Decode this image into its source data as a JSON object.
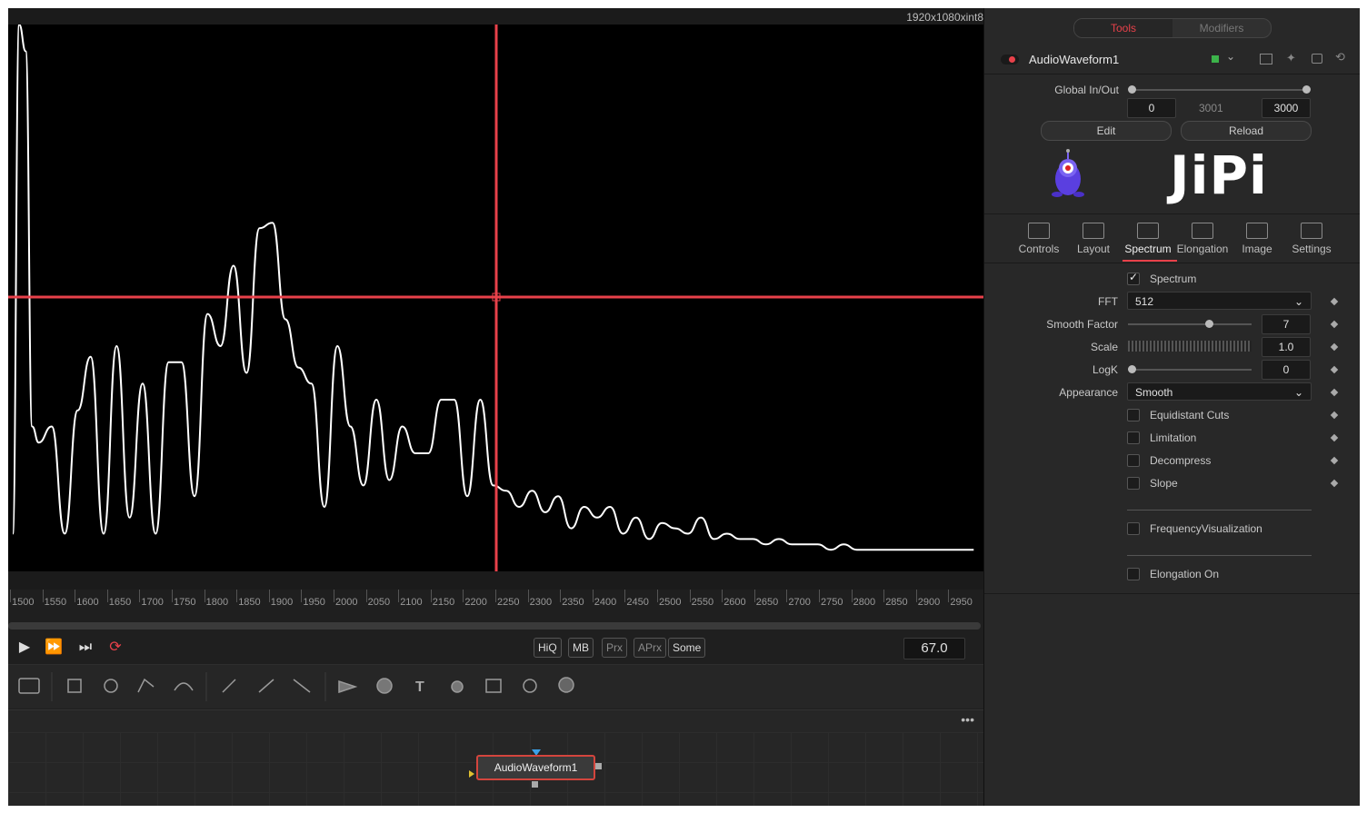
{
  "viewer": {
    "resolution": "1920x1080xint8",
    "chart_data": {
      "type": "line",
      "title": "",
      "series": [
        {
          "x": [
            1500,
            1510,
            1520,
            1530,
            1540,
            1560,
            1580,
            1600,
            1620,
            1640,
            1660,
            1680,
            1700,
            1720,
            1740,
            1760,
            1780,
            1800,
            1820,
            1840,
            1860,
            1880,
            1900,
            1920,
            1940,
            1960,
            1980,
            2000,
            2020,
            2040,
            2060,
            2080,
            2100,
            2120,
            2140,
            2160,
            2180,
            2200,
            2220,
            2240,
            2260,
            2280,
            2300,
            2320,
            2340,
            2360,
            2380,
            2400,
            2420,
            2440,
            2460,
            2480,
            2500,
            2520,
            2540,
            2560,
            2580,
            2600,
            2620,
            2640,
            2660,
            2680,
            2700,
            2720,
            2740,
            2760,
            2780,
            2800,
            2820,
            2840,
            2860,
            2880,
            2900,
            2920,
            2940,
            2960,
            2980
          ],
          "values": [
            0.05,
            1.0,
            0.95,
            0.25,
            0.22,
            0.25,
            0.05,
            0.28,
            0.38,
            0.05,
            0.4,
            0.08,
            0.33,
            0.05,
            0.37,
            0.37,
            0.12,
            0.46,
            0.4,
            0.55,
            0.35,
            0.62,
            0.63,
            0.45,
            0.36,
            0.33,
            0.1,
            0.4,
            0.25,
            0.14,
            0.3,
            0.15,
            0.25,
            0.2,
            0.2,
            0.3,
            0.3,
            0.12,
            0.3,
            0.14,
            0.13,
            0.1,
            0.13,
            0.09,
            0.12,
            0.06,
            0.1,
            0.08,
            0.1,
            0.05,
            0.08,
            0.04,
            0.07,
            0.06,
            0.05,
            0.08,
            0.04,
            0.05,
            0.04,
            0.04,
            0.03,
            0.04,
            0.03,
            0.03,
            0.03,
            0.02,
            0.03,
            0.02,
            0.02,
            0.02,
            0.02,
            0.02,
            0.02,
            0.02,
            0.02,
            0.02,
            0.02
          ]
        }
      ]
    }
  },
  "ruler": {
    "ticks": [
      "1500",
      "1550",
      "1600",
      "1650",
      "1700",
      "1750",
      "1800",
      "1850",
      "1900",
      "1950",
      "2000",
      "2050",
      "2100",
      "2150",
      "2200",
      "2250",
      "2300",
      "2350",
      "2400",
      "2450",
      "2500",
      "2550",
      "2600",
      "2650",
      "2700",
      "2750",
      "2800",
      "2850",
      "2900",
      "2950"
    ]
  },
  "transport": {
    "quality": [
      {
        "label": "HiQ",
        "dim": false
      },
      {
        "label": "MB",
        "dim": false
      },
      {
        "label": "Prx",
        "dim": true
      },
      {
        "label": "APrx",
        "dim": true
      },
      {
        "label": "Some",
        "dim": false
      }
    ],
    "frame": "67.0"
  },
  "flow": {
    "node_label": "AudioWaveform1"
  },
  "inspector": {
    "tab_tools": "Tools",
    "tab_modifiers": "Modifiers",
    "node_name": "AudioWaveform1",
    "global_label": "Global In/Out",
    "global_in": "0",
    "global_mid": "3001",
    "global_out": "3000",
    "edit_label": "Edit",
    "reload_label": "Reload",
    "logo_text": "JiPi",
    "tabs": [
      "Controls",
      "Layout",
      "Spectrum",
      "Elongation",
      "Image",
      "Settings"
    ],
    "spectrum_label": "Spectrum",
    "fft_label": "FFT",
    "fft_value": "512",
    "smooth_label": "Smooth Factor",
    "smooth_value": "7",
    "scale_label": "Scale",
    "scale_value": "1.0",
    "logk_label": "LogK",
    "logk_value": "0",
    "appearance_label": "Appearance",
    "appearance_value": "Smooth",
    "checks": [
      "Equidistant Cuts",
      "Limitation",
      "Decompress",
      "Slope"
    ],
    "freqvis": "FrequencyVisualization",
    "elong_on": "Elongation On",
    "accent": "#e8414a"
  }
}
